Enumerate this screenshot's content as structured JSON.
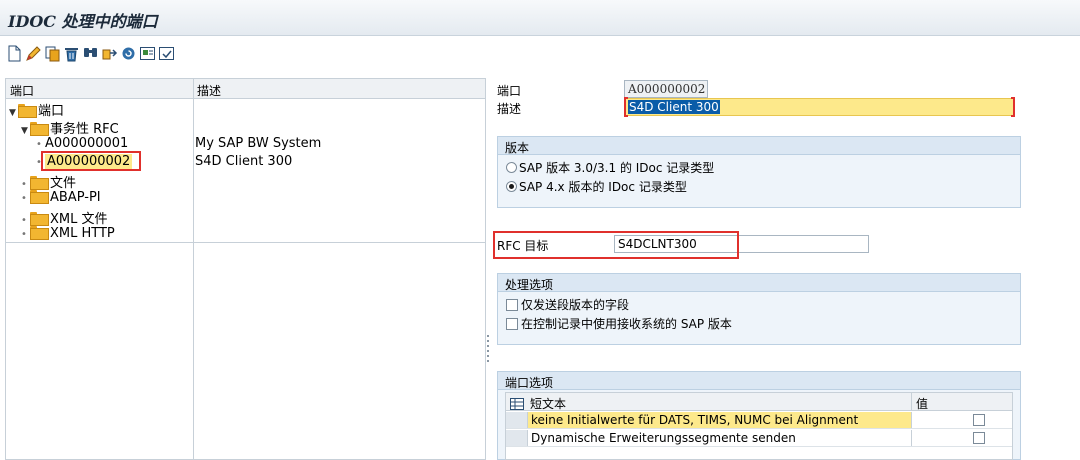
{
  "window": {
    "title": "IDOC 处理中的端口"
  },
  "toolbar": {
    "icons": [
      "new-icon",
      "edit-icon",
      "copy-icon",
      "delete-icon",
      "find-icon",
      "transfer-icon",
      "refresh-icon",
      "test-icon",
      "check-icon"
    ]
  },
  "tree": {
    "columns": {
      "port": "端口",
      "description": "描述"
    },
    "root": "端口",
    "transactional_rfc": "事务性 RFC",
    "ports": [
      {
        "name": "A000000001",
        "description": "My SAP BW System"
      },
      {
        "name": "A000000002",
        "description": "S4D Client 300"
      }
    ],
    "others": [
      "文件",
      "ABAP-PI",
      "XML 文件",
      "XML HTTP"
    ]
  },
  "detail": {
    "port_label": "端口",
    "port_value": "A000000002",
    "desc_label": "描述",
    "desc_value": "S4D Client 300",
    "version": {
      "header": "版本",
      "option1": "SAP 版本 3.0/3.1 的 IDoc 记录类型",
      "option2": "SAP 4.x 版本的 IDoc 记录类型",
      "selected": "option2"
    },
    "rfc": {
      "label": "RFC 目标",
      "value": "S4DCLNT300"
    },
    "processing": {
      "header": "处理选项",
      "option1": "仅发送段版本的字段",
      "option2": "在控制记录中使用接收系统的 SAP 版本"
    },
    "port_options": {
      "header": "端口选项",
      "col_text": "短文本",
      "col_value": "值",
      "rows": [
        {
          "text": "keine Initialwerte für DATS, TIMS, NUMC bei Alignment"
        },
        {
          "text": "Dynamische Erweiterungssegmente senden"
        }
      ]
    }
  },
  "colors": {
    "highlight": "#fde98b",
    "selection": "#0a5ca8",
    "red_marker": "#e0302c",
    "group_bg": "#eef4fa",
    "group_header": "#dbe7f3"
  }
}
